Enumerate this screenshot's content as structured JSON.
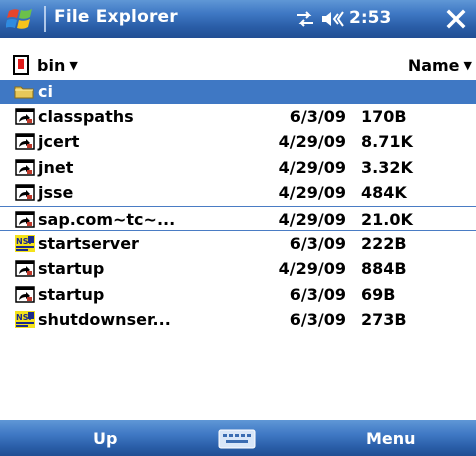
{
  "titlebar": {
    "start_icon": "windows-flag-icon",
    "title": "File Explorer",
    "connectivity_icon": "connectivity-icon",
    "volume_icon": "volume-icon",
    "time": "2:53",
    "close_label": "X"
  },
  "toolbar": {
    "storage_icon": "storage-card-icon",
    "folder_name": "bin",
    "sort_label": "Name"
  },
  "current_folder": {
    "icon": "folder-icon",
    "name": "ci"
  },
  "files": [
    {
      "name": "classpaths",
      "date": "6/3/09",
      "size": "170B",
      "icon": "shortcut-icon"
    },
    {
      "name": "jcert",
      "date": "4/29/09",
      "size": "8.71K",
      "icon": "shortcut-icon"
    },
    {
      "name": "jnet",
      "date": "4/29/09",
      "size": "3.32K",
      "icon": "shortcut-icon"
    },
    {
      "name": "jsse",
      "date": "4/29/09",
      "size": "484K",
      "icon": "shortcut-icon"
    },
    {
      "name": "sap.com~tc~...",
      "date": "4/29/09",
      "size": "21.0K",
      "icon": "shortcut-icon",
      "selected": true
    },
    {
      "name": "startserver",
      "date": "6/3/09",
      "size": "222B",
      "icon": "nsis-script-icon"
    },
    {
      "name": "startup",
      "date": "4/29/09",
      "size": "884B",
      "icon": "shortcut-icon"
    },
    {
      "name": "startup",
      "date": "6/3/09",
      "size": "69B",
      "icon": "shortcut-icon"
    },
    {
      "name": "shutdownser...",
      "date": "6/3/09",
      "size": "273B",
      "icon": "nsis-script-icon"
    }
  ],
  "softkeys": {
    "left": "Up",
    "center_icon": "keyboard-icon",
    "right": "Menu"
  },
  "colors": {
    "bar_blue": "#3f78c4",
    "selection_blue": "#4a7cc4"
  }
}
